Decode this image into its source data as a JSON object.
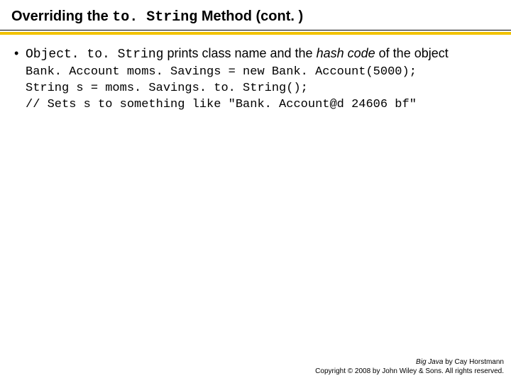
{
  "title": {
    "pre": "Overriding the ",
    "code": "to. String",
    "post": " Method  (cont. )"
  },
  "bullet": {
    "code": "Object. to. String",
    "text1": "  prints class name and the ",
    "italic": "hash code",
    "text2": " of the object"
  },
  "code": "Bank. Account moms. Savings = new Bank. Account(5000);\nString s = moms. Savings. to. String();\n// Sets s to something like \"Bank. Account@d 24606 bf\"",
  "footer": {
    "book": "Big Java",
    "byline": " by Cay Horstmann",
    "copyright": "Copyright © 2008 by John Wiley & Sons. All rights reserved."
  }
}
